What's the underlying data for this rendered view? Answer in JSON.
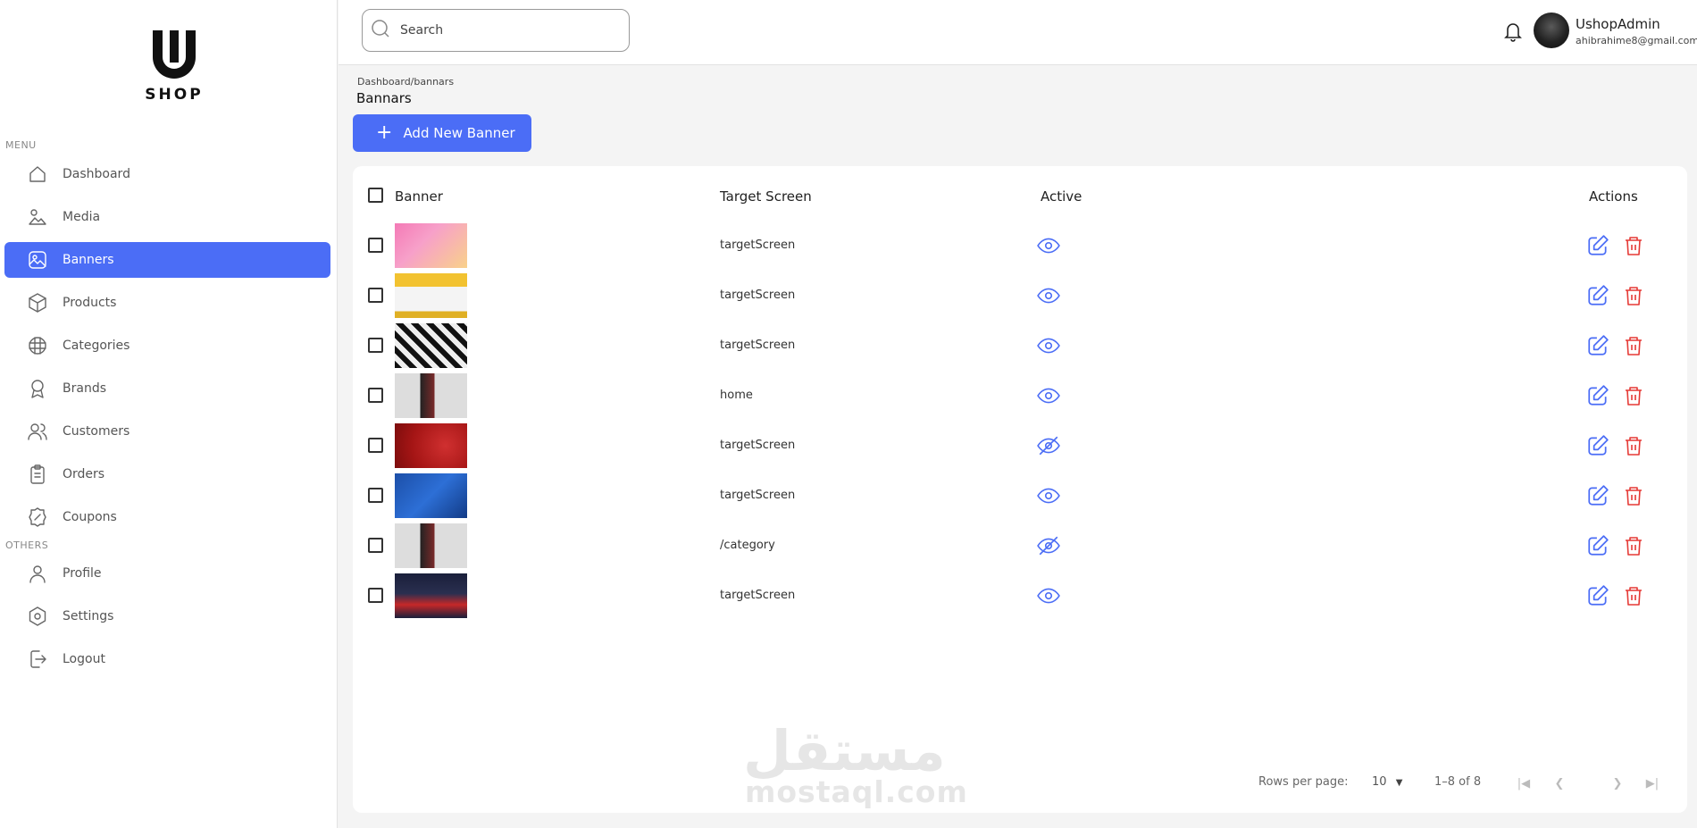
{
  "brand": {
    "logo_text": "SHOP"
  },
  "sidebar": {
    "menu_label": "MENU",
    "others_label": "OTHERS",
    "menu_items": [
      {
        "label": "Dashboard",
        "icon": "home-icon"
      },
      {
        "label": "Media",
        "icon": "media-icon"
      },
      {
        "label": "Banners",
        "icon": "image-icon",
        "active": true
      },
      {
        "label": "Products",
        "icon": "box-icon"
      },
      {
        "label": "Categories",
        "icon": "grid-icon"
      },
      {
        "label": "Brands",
        "icon": "award-icon"
      },
      {
        "label": "Customers",
        "icon": "users-icon"
      },
      {
        "label": "Orders",
        "icon": "clipboard-icon"
      },
      {
        "label": "Coupons",
        "icon": "discount-icon"
      }
    ],
    "other_items": [
      {
        "label": "Profile",
        "icon": "user-icon"
      },
      {
        "label": "Settings",
        "icon": "gear-icon"
      },
      {
        "label": "Logout",
        "icon": "logout-icon"
      }
    ]
  },
  "header": {
    "search_placeholder": "Search",
    "user_name": "UshopAdmin",
    "user_email": "ahibrahime8@gmail.com"
  },
  "page": {
    "breadcrumb": "Dashboard/bannars",
    "title": "Bannars",
    "add_button": "Add New Banner"
  },
  "table": {
    "columns": [
      "Banner",
      "Target Screen",
      "Active",
      "Actions"
    ],
    "rows": [
      {
        "target": "targetScreen",
        "active": true,
        "thumb": "pink-sneaker"
      },
      {
        "target": "targetScreen",
        "active": true,
        "thumb": "yellow-products"
      },
      {
        "target": "targetScreen",
        "active": true,
        "thumb": "bw-shoes"
      },
      {
        "target": "home",
        "active": true,
        "thumb": "adidas-person"
      },
      {
        "target": "targetScreen",
        "active": false,
        "thumb": "red-sale"
      },
      {
        "target": "targetScreen",
        "active": true,
        "thumb": "blue-promo"
      },
      {
        "target": "/category",
        "active": false,
        "thumb": "adidas-person"
      },
      {
        "target": "targetScreen",
        "active": true,
        "thumb": "red-sneakers"
      }
    ]
  },
  "pagination": {
    "rows_per_page_label": "Rows per page:",
    "rows_per_page": "10",
    "range": "1–8 of 8"
  },
  "colors": {
    "accent": "#4b6df6",
    "danger": "#e53935"
  },
  "watermark": {
    "arabic": "مستقل",
    "latin": "mostaql.com"
  }
}
